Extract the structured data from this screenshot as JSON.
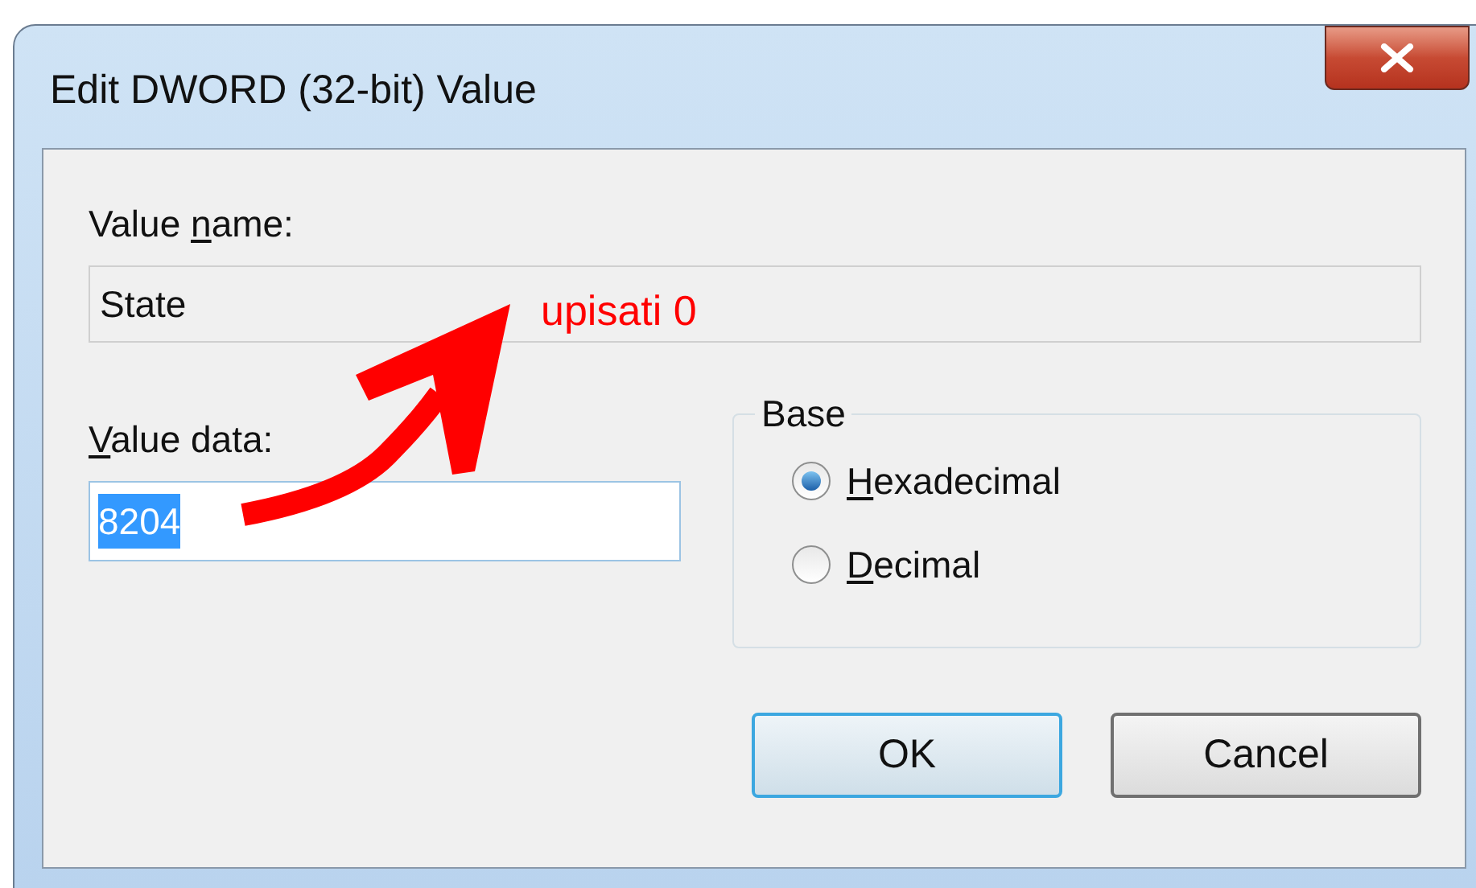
{
  "window": {
    "title": "Edit DWORD (32-bit) Value"
  },
  "value_name": {
    "label": {
      "before": "Value ",
      "key": "n",
      "after": "ame:"
    },
    "value": "State"
  },
  "value_data": {
    "label": {
      "key": "V",
      "after": "alue data:"
    },
    "value": "8204",
    "text_selected": true
  },
  "base": {
    "label": "Base",
    "options": [
      {
        "label": {
          "key": "H",
          "after": "exadecimal"
        },
        "selected": true
      },
      {
        "label": {
          "key": "D",
          "after": "ecimal"
        },
        "selected": false
      }
    ]
  },
  "buttons": [
    {
      "label": "OK",
      "default": true
    },
    {
      "label": "Cancel",
      "default": false
    }
  ],
  "annotation": {
    "text": "upisati 0"
  }
}
